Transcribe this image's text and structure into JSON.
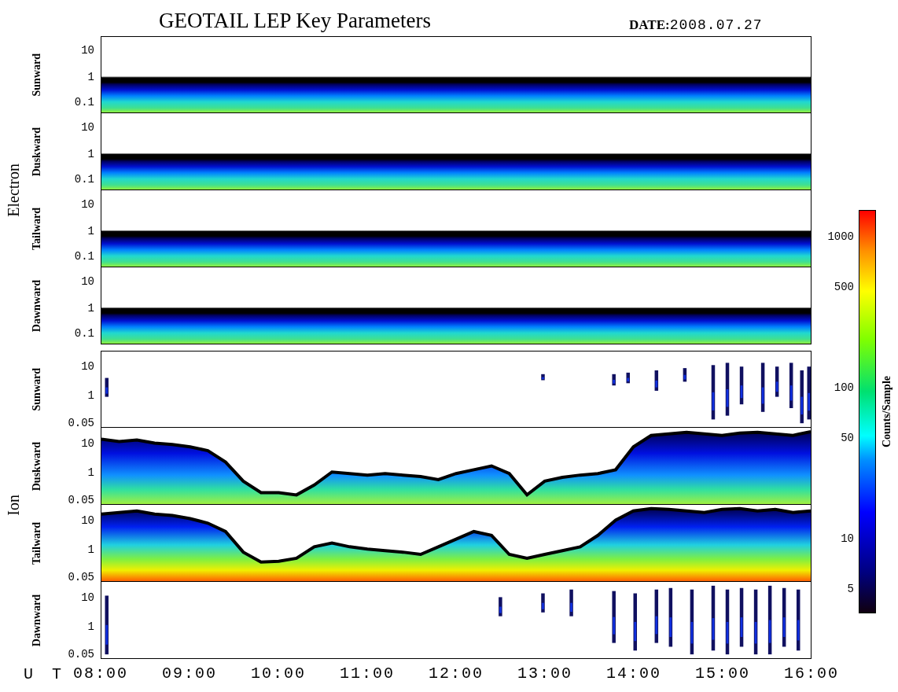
{
  "title": "GEOTAIL LEP Key Parameters",
  "date": {
    "label": "DATE:",
    "value": "2008.07.27"
  },
  "groups": [
    {
      "name": "Electron",
      "kind": "electron",
      "panels": [
        {
          "name": "Sunward",
          "kind": "band",
          "yticks": [
            "10",
            "1",
            "0.1"
          ]
        },
        {
          "name": "Duskward",
          "kind": "band",
          "yticks": [
            "10",
            "1",
            "0.1"
          ]
        },
        {
          "name": "Tailward",
          "kind": "band",
          "yticks": [
            "10",
            "1",
            "0.1"
          ]
        },
        {
          "name": "Dawnward",
          "kind": "band",
          "yticks": [
            "10",
            "1",
            "0.1"
          ]
        }
      ]
    },
    {
      "name": "Ion",
      "kind": "ion",
      "panels": [
        {
          "name": "Sunward",
          "kind": "sparse",
          "yticks": [
            "10",
            "1",
            "0.05"
          ]
        },
        {
          "name": "Duskward",
          "kind": "envelope",
          "yticks": [
            "10",
            "1",
            "0.05"
          ]
        },
        {
          "name": "Tailward",
          "kind": "envelope_hot",
          "yticks": [
            "10",
            "1",
            "0.05"
          ]
        },
        {
          "name": "Dawnward",
          "kind": "sparse",
          "yticks": [
            "10",
            "1",
            "0.05"
          ]
        }
      ]
    }
  ],
  "x_axis": {
    "label": "U T",
    "ticks": [
      "08:00",
      "09:00",
      "10:00",
      "11:00",
      "12:00",
      "13:00",
      "14:00",
      "15:00",
      "16:00"
    ]
  },
  "colorbar": {
    "label": "Counts/Sample",
    "ticks": [
      "1000",
      "500",
      "100",
      "50",
      "10",
      "5"
    ]
  }
}
